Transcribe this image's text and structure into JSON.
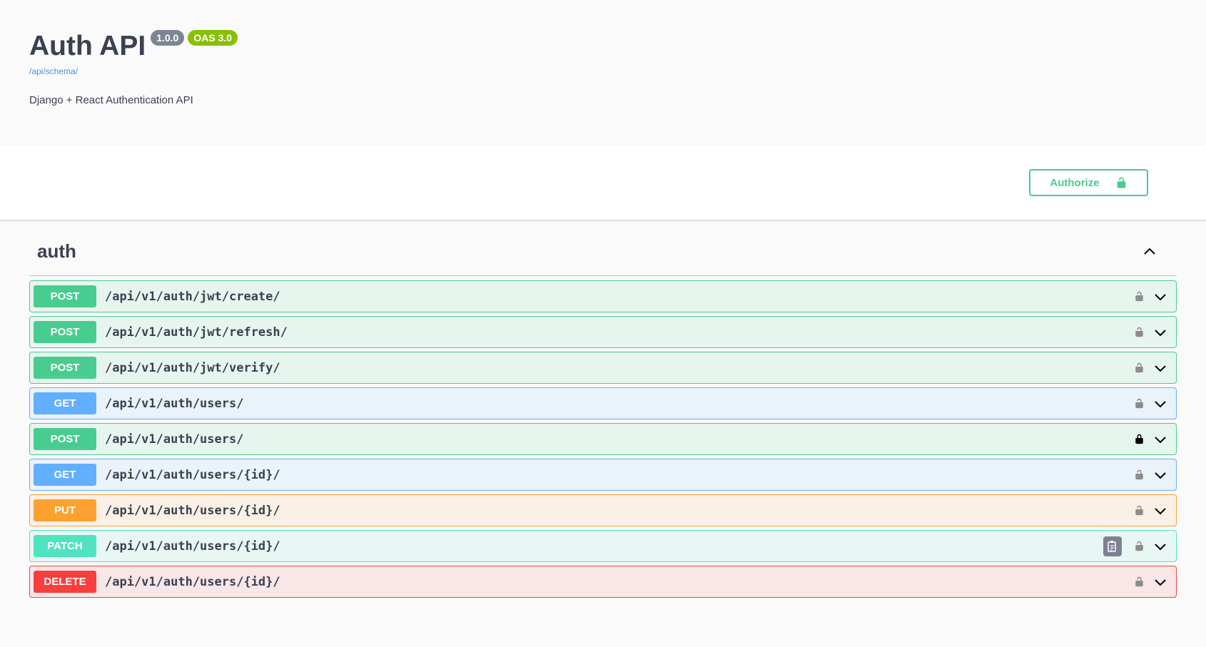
{
  "info": {
    "title": "Auth API",
    "version_badge": "1.0.0",
    "oas_badge": "OAS 3.0",
    "schema_link": "/api/schema/",
    "description": "Django + React Authentication API"
  },
  "scheme": {
    "authorize_label": "Authorize",
    "authorize_icon": "unlock-icon",
    "accent_color": "#49cc90"
  },
  "tag": {
    "name": "auth",
    "expanded": true
  },
  "operations": [
    {
      "method": "POST",
      "path": "/api/v1/auth/jwt/create/",
      "locked": false,
      "color": "#49cc90"
    },
    {
      "method": "POST",
      "path": "/api/v1/auth/jwt/refresh/",
      "locked": false,
      "color": "#49cc90"
    },
    {
      "method": "POST",
      "path": "/api/v1/auth/jwt/verify/",
      "locked": false,
      "color": "#49cc90"
    },
    {
      "method": "GET",
      "path": "/api/v1/auth/users/",
      "locked": false,
      "color": "#61affe"
    },
    {
      "method": "POST",
      "path": "/api/v1/auth/users/",
      "locked": true,
      "color": "#49cc90"
    },
    {
      "method": "GET",
      "path": "/api/v1/auth/users/{id}/",
      "locked": false,
      "color": "#61affe"
    },
    {
      "method": "PUT",
      "path": "/api/v1/auth/users/{id}/",
      "locked": false,
      "color": "#fca130"
    },
    {
      "method": "PATCH",
      "path": "/api/v1/auth/users/{id}/",
      "locked": false,
      "color": "#50e3c2",
      "copy_button": true
    },
    {
      "method": "DELETE",
      "path": "/api/v1/auth/users/{id}/",
      "locked": false,
      "color": "#f93e3e"
    }
  ]
}
